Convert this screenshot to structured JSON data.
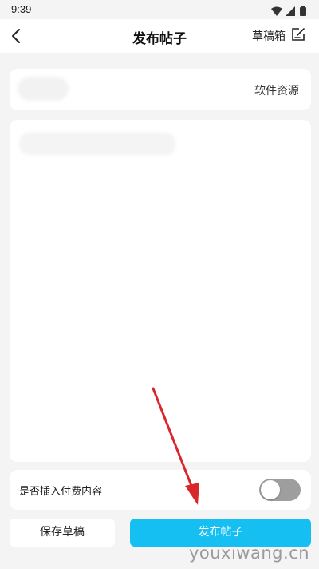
{
  "status_bar": {
    "time": "9:39",
    "icons": [
      "wifi-icon",
      "signal-icon",
      "battery-icon"
    ]
  },
  "header": {
    "title": "发布帖子",
    "back_icon": "chevron-left-icon",
    "drafts_label": "草稿箱",
    "drafts_icon": "edit-note-icon"
  },
  "category": {
    "label": "软件资源"
  },
  "pay_content": {
    "label": "是否插入付费内容",
    "enabled": false
  },
  "actions": {
    "save_label": "保存草稿",
    "publish_label": "发布帖子"
  },
  "colors": {
    "accent": "#16bff2",
    "toggle_off": "#9e9e9e",
    "arrow": "#d9262b"
  },
  "watermark": "youxiwang.cn"
}
